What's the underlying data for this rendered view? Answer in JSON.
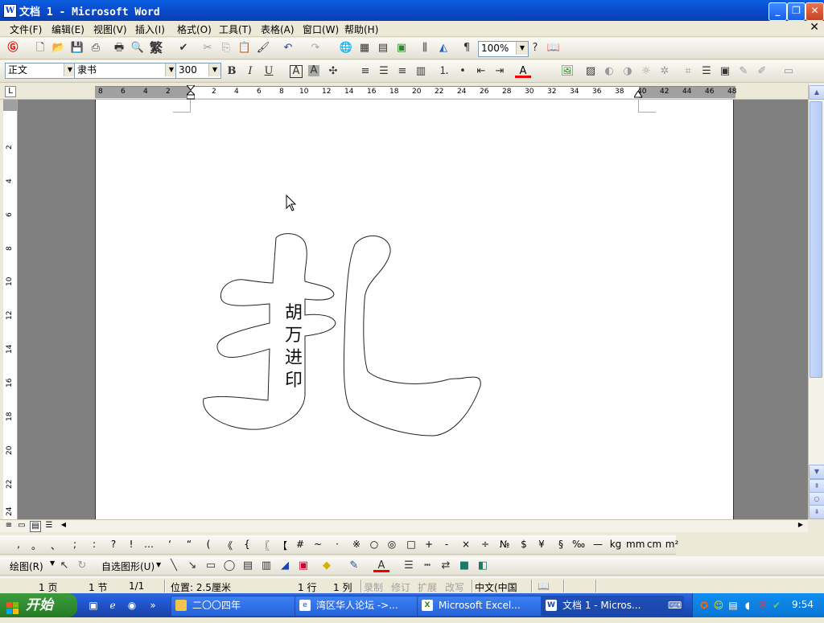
{
  "window": {
    "title": "文档 1 - Microsoft Word",
    "icon": "word-icon"
  },
  "menu": {
    "items": [
      "文件(F)",
      "编辑(E)",
      "视图(V)",
      "插入(I)",
      "格式(O)",
      "工具(T)",
      "表格(A)",
      "窗口(W)",
      "帮助(H)"
    ]
  },
  "toolbar_standard": {
    "fan_label": "繁",
    "zoom": "100%"
  },
  "toolbar_format": {
    "style": "正文",
    "font": "隶书",
    "size": "300",
    "bold": "B",
    "italic": "I",
    "underline": "U",
    "char_border": "A",
    "char_shade": "A",
    "font_color": "A"
  },
  "ruler": {
    "numbers": [
      "8",
      "6",
      "4",
      "2",
      "2",
      "4",
      "6",
      "8",
      "10",
      "12",
      "14",
      "16",
      "18",
      "20",
      "22",
      "24",
      "26",
      "28",
      "30",
      "32",
      "34",
      "36",
      "38",
      "40",
      "42",
      "44",
      "46",
      "48"
    ]
  },
  "vruler": {
    "numbers": [
      "2",
      "4",
      "6",
      "8",
      "10",
      "12",
      "14",
      "16",
      "18",
      "20",
      "22",
      "24"
    ]
  },
  "document": {
    "glyph": "扎",
    "seal": [
      "胡",
      "万",
      "进",
      "印"
    ]
  },
  "symbols": [
    ",",
    "。",
    "、",
    ";",
    ":",
    "?",
    "!",
    "…",
    "‘",
    "“",
    "(",
    "《",
    "{",
    "〖",
    "【",
    "#",
    "~",
    "·",
    "※",
    "○",
    "◎",
    "□",
    "+",
    "-",
    "×",
    "÷",
    "№",
    "$",
    "¥",
    "§",
    "‰",
    "—",
    "kg",
    "mm",
    "cm",
    "m²"
  ],
  "drawing": {
    "draw_label": "绘图(R)",
    "autoshape_label": "自选图形(U)",
    "font_color": "A"
  },
  "status": {
    "page": "1 页",
    "section": "1 节",
    "pages": "1/1",
    "position": "位置: 2.5厘米",
    "line": "1 行",
    "col": "1 列",
    "rec": "录制",
    "trk": "修订",
    "ext": "扩展",
    "ovr": "改写",
    "lang": "中文(中国"
  },
  "taskbar": {
    "start": "开始",
    "tasks": [
      {
        "label": "二〇〇四年",
        "icon": "folder-icon"
      },
      {
        "label": "湾区华人论坛 ->...",
        "icon": "ie-icon"
      },
      {
        "label": "Microsoft Excel...",
        "icon": "excel-icon"
      },
      {
        "label": "文档 1 - Micros...",
        "icon": "word-icon"
      }
    ],
    "clock": "9:54"
  }
}
